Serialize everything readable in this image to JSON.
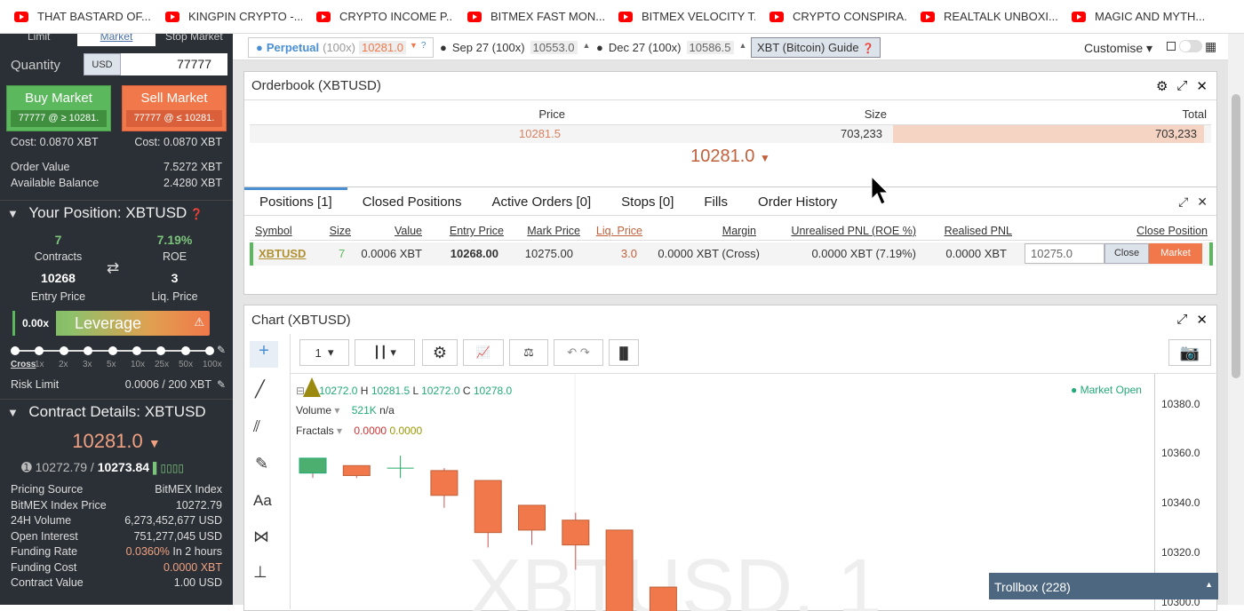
{
  "bookmarks": [
    "THAT BASTARD OF...",
    "KINGPIN CRYPTO -...",
    "CRYPTO INCOME P...",
    "BITMEX FAST MON...",
    "BITMEX VELOCITY T...",
    "CRYPTO CONSPIRA...",
    "REALTALK UNBOXI...",
    "MAGIC AND MYTH..."
  ],
  "order_form": {
    "tabs": [
      "Limit",
      "Market",
      "Stop Market"
    ],
    "quantity_label": "Quantity",
    "currency": "USD",
    "quantity_value": "77777",
    "buy": {
      "label": "Buy Market",
      "sub": "77777 @ ≥ 10281.",
      "cost": "Cost: 0.0870 XBT"
    },
    "sell": {
      "label": "Sell Market",
      "sub": "77777 @ ≤ 10281.",
      "cost": "Cost: 0.0870 XBT"
    },
    "order_value_label": "Order Value",
    "order_value": "7.5272 XBT",
    "avail_label": "Available Balance",
    "avail": "2.4280 XBT"
  },
  "position": {
    "title": "Your Position: XBTUSD",
    "contracts": "7",
    "contracts_label": "Contracts",
    "roe": "7.19%",
    "roe_label": "ROE",
    "entry": "10268",
    "entry_label": "Entry Price",
    "liq": "3",
    "liq_label": "Liq. Price",
    "leverage_value": "0.00x",
    "leverage_label": "Leverage",
    "lev_ticks": [
      "Cross",
      "1x",
      "2x",
      "3x",
      "5x",
      "10x",
      "25x",
      "50x",
      "100x"
    ],
    "risk_label": "Risk Limit",
    "risk_value": "0.0006 / 200 XBT"
  },
  "contract": {
    "title": "Contract Details: XBTUSD",
    "price": "10281.0",
    "index": "10272.79",
    "mark": "10273.84",
    "rows": [
      {
        "k": "Pricing Source",
        "v": "BitMEX Index"
      },
      {
        "k": "BitMEX Index Price",
        "v": "10272.79"
      },
      {
        "k": "24H Volume",
        "v": "6,273,452,677 USD"
      },
      {
        "k": "Open Interest",
        "v": "751,277,045 USD"
      },
      {
        "k": "Funding Rate",
        "v": "0.0360%",
        "v2": "In 2 hours"
      },
      {
        "k": "Funding Cost",
        "v": "0.0000 XBT"
      },
      {
        "k": "Contract Value",
        "v": "1.00 USD"
      }
    ]
  },
  "topbar": {
    "perpetual": "Perpetual",
    "perp_lev": "(100x)",
    "perp_price": "10281.0",
    "sep": "Sep 27 (100x)",
    "sep_price": "10553.0",
    "dec": "Dec 27 (100x)",
    "dec_price": "10586.5",
    "guide": "XBT (Bitcoin) Guide",
    "customise": "Customise"
  },
  "orderbook": {
    "title": "Orderbook (XBTUSD)",
    "cols": [
      "Price",
      "Size",
      "Total"
    ],
    "row": {
      "price": "10281.5",
      "size": "703,233",
      "total": "703,233"
    },
    "last": "10281.0"
  },
  "positions": {
    "tabs": [
      "Positions [1]",
      "Closed Positions",
      "Active Orders [0]",
      "Stops [0]",
      "Fills",
      "Order History"
    ],
    "cols": [
      "Symbol",
      "Size",
      "Value",
      "Entry Price",
      "Mark Price",
      "Liq. Price",
      "Margin",
      "Unrealised PNL (ROE %)",
      "Realised PNL",
      "Close Position"
    ],
    "row": {
      "symbol": "XBTUSD",
      "size": "7",
      "value": "0.0006 XBT",
      "entry": "10268.00",
      "mark": "10275.00",
      "liq": "3.0",
      "margin": "0.0000 XBT (Cross)",
      "upnl": "0.0000 XBT (7.19%)",
      "rpnl": "0.0000 XBT",
      "close_price": "10275.0",
      "close_btn": "Close",
      "market_btn": "Market"
    }
  },
  "chart": {
    "title": "Chart (XBTUSD)",
    "interval": "1",
    "ohlc": {
      "o": "10272.0",
      "h": "10281.5",
      "l": "10272.0",
      "c": "10278.0"
    },
    "volume_label": "Volume",
    "volume": "521K",
    "volume_na": "n/a",
    "fractals_label": "Fractals",
    "fractal_a": "0.0000",
    "fractal_b": "0.0000",
    "market_status": "Market Open",
    "watermark": "XBTUSD, 1",
    "y_ticks": [
      "10380.0",
      "10360.0",
      "10340.0",
      "10320.0",
      "10300.0"
    ],
    "trollbox": "Trollbox (228)"
  },
  "chart_data": {
    "type": "candlestick",
    "ylim": [
      10296,
      10392
    ],
    "candles": [
      {
        "o": 10352,
        "h": 10358,
        "l": 10350,
        "c": 10358,
        "dir": "up"
      },
      {
        "o": 10355,
        "h": 10355,
        "l": 10350,
        "c": 10351,
        "dir": "down"
      },
      {
        "o": 10354,
        "h": 10359,
        "l": 10350,
        "c": 10354,
        "dir": "flat"
      },
      {
        "o": 10353,
        "h": 10354,
        "l": 10338,
        "c": 10343,
        "dir": "down"
      },
      {
        "o": 10349,
        "h": 10349,
        "l": 10322,
        "c": 10328,
        "dir": "down"
      },
      {
        "o": 10339,
        "h": 10339,
        "l": 10323,
        "c": 10329,
        "dir": "down"
      },
      {
        "o": 10333,
        "h": 10336,
        "l": 10313,
        "c": 10323,
        "dir": "down"
      },
      {
        "o": 10329,
        "h": 10329,
        "l": 10290,
        "c": 10290,
        "dir": "down"
      },
      {
        "o": 10306,
        "h": 10306,
        "l": 10290,
        "c": 10290,
        "dir": "down"
      }
    ],
    "colors": {
      "up": "#4caf70",
      "down": "#f0784a"
    }
  }
}
